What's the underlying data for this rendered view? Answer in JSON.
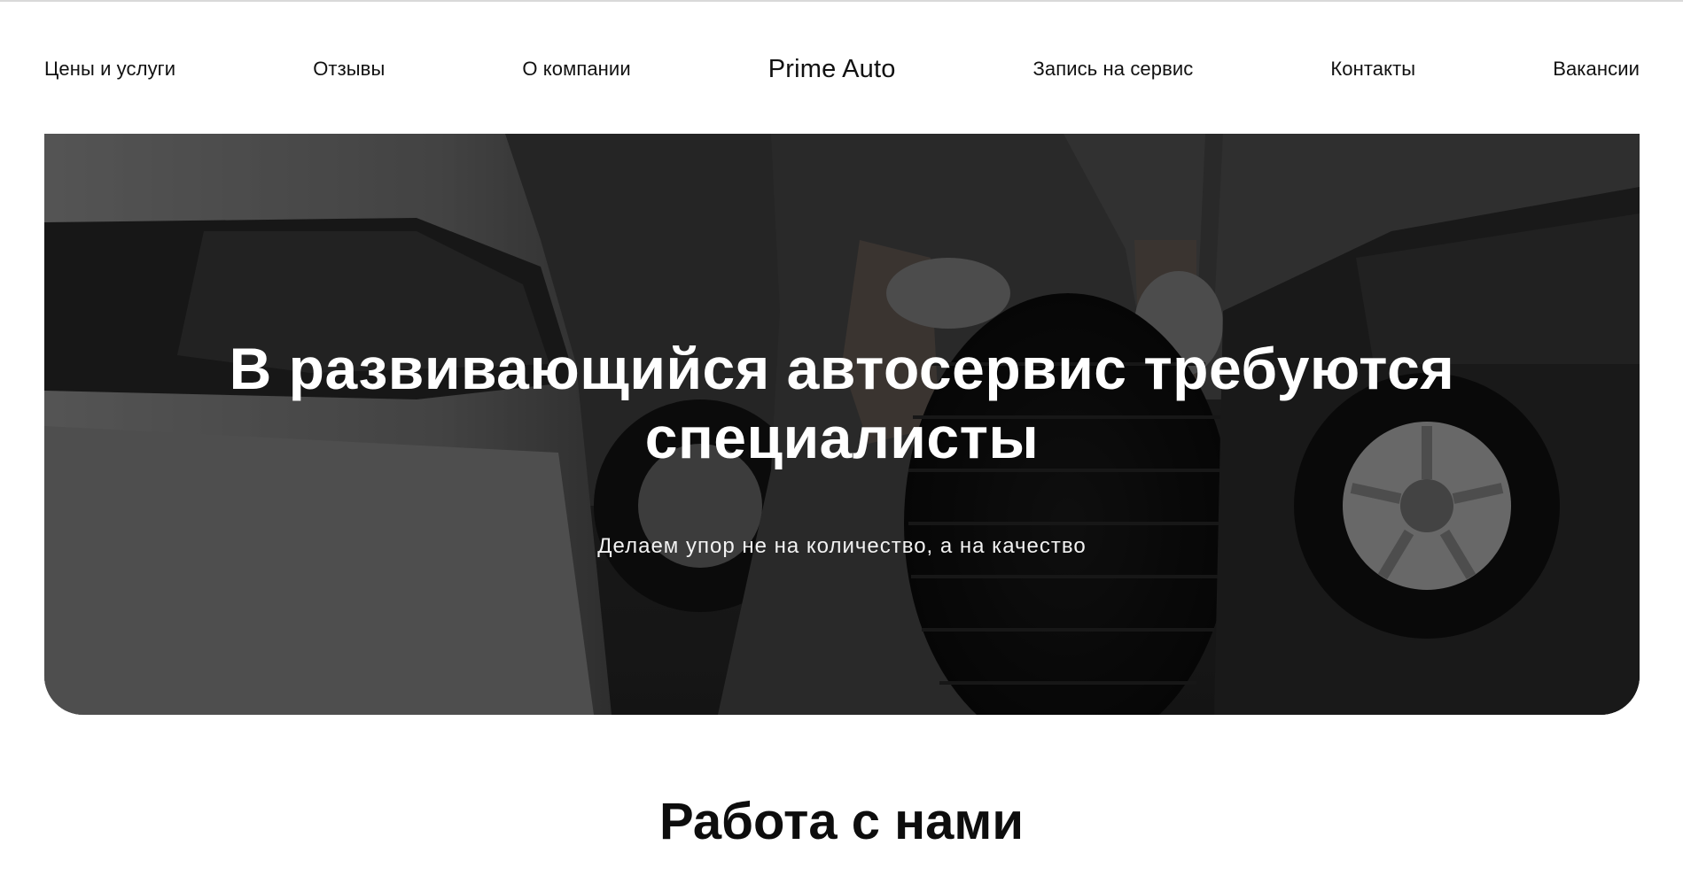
{
  "nav": {
    "items": [
      {
        "label": "Цены и услуги"
      },
      {
        "label": "Отзывы"
      },
      {
        "label": "О компании"
      },
      {
        "label": "Prime Auto"
      },
      {
        "label": "Запись на сервис"
      },
      {
        "label": "Контакты"
      },
      {
        "label": "Вакансии"
      }
    ]
  },
  "hero": {
    "title": "В развивающийся автосервис требуются специалисты",
    "subtitle": "Делаем упор не на количество, а на качество",
    "image_icon": "mechanic-with-tire-photo"
  },
  "section": {
    "title": "Работа с нами"
  },
  "colors": {
    "overlay": "#000000",
    "text_light": "#ffffff",
    "text_dark": "#111111"
  }
}
